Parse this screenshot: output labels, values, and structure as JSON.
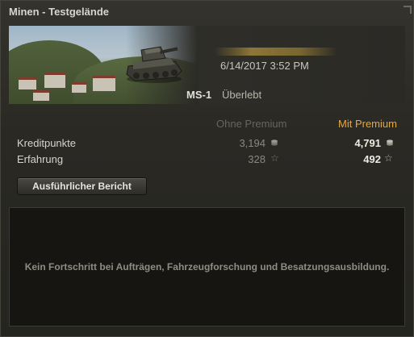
{
  "window": {
    "title": "Minen - Testgelände"
  },
  "battle": {
    "date_time": "6/14/2017 3:52 PM",
    "vehicle_name": "MS-1",
    "vehicle_status": "Überlebt",
    "map_name_icon": "map-thumbnail",
    "vehicle_icon": "tank-icon"
  },
  "economics": {
    "column_free": "Ohne Premium",
    "column_premium": "Mit Premium",
    "rows": [
      {
        "label": "Kreditpunkte",
        "free": "3,194",
        "premium": "4,791",
        "icon": "credits-icon"
      },
      {
        "label": "Erfahrung",
        "free": "328",
        "premium": "492",
        "icon": "xp-star-icon"
      }
    ]
  },
  "actions": {
    "detailed_report_label": "Ausführlicher Bericht"
  },
  "progress": {
    "message": "Kein Fortschritt bei Aufträgen, Fahrzeugforschung und Besatzungsausbildung."
  },
  "colors": {
    "premium_accent": "#e8a73c",
    "background": "#2b2a25",
    "panel": "#161511"
  }
}
